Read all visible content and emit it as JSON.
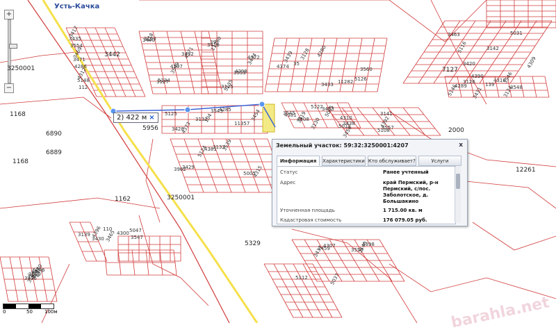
{
  "map": {
    "town_label": "Усть-Качка",
    "measure_label": "2) 422 м",
    "measure_close": "×",
    "zoom_in": "+",
    "zoom_out": "−",
    "zoom_fraction": 0.4,
    "scale_ticks": [
      "0",
      "50",
      "100м"
    ],
    "watermark": "barahla.net",
    "labels_big": [
      "3250001",
      "3250001",
      "1168",
      "6890",
      "6889",
      "1168",
      "3442",
      "1162",
      "5329",
      "7127",
      "2000",
      "12261",
      "5956"
    ],
    "labels_parcels": [
      "3417",
      "3440",
      "3418",
      "3439",
      "3428",
      "3429",
      "3419",
      "3438",
      "3420",
      "3437",
      "3430",
      "3436",
      "3431",
      "3435",
      "3432",
      "3434",
      "3433",
      "3543",
      "3539",
      "3545",
      "3557",
      "3546",
      "3556",
      "3547",
      "3555",
      "3548",
      "3554",
      "3549",
      "3553",
      "3560",
      "3454",
      "3962",
      "3453",
      "3456",
      "3463",
      "3459",
      "3465",
      "3468",
      "3126",
      "3469",
      "3127",
      "3125",
      "3128",
      "3131",
      "3133",
      "3130",
      "3141",
      "3142",
      "3140",
      "3139",
      "3129",
      "3124",
      "3471",
      "3123",
      "11280",
      "11282",
      "11357",
      "4315",
      "4308",
      "4310",
      "4309",
      "4307",
      "4300",
      "4287",
      "4289",
      "4286",
      "4371",
      "4372",
      "4374",
      "4373",
      "4381",
      "4381",
      "4392",
      "4390",
      "4398",
      "4396",
      "4317",
      "4316",
      "4312",
      "4297",
      "4298",
      "4280",
      "4285",
      "5005",
      "5005",
      "5013",
      "5031",
      "5037",
      "5047",
      "5145",
      "5146",
      "5148",
      "5134",
      "5135",
      "5126",
      "5125",
      "5124",
      "5122",
      "5108",
      "5116",
      "5112",
      "110",
      "140",
      "139",
      "112",
      "118",
      "39",
      "35",
      "104"
    ],
    "popup": {
      "title": "Земельный участок: 59:32:3250001:4207",
      "close": "x",
      "tabs": [
        "Информация",
        "Характеристики",
        "Кто обслуживает?",
        "Услуги"
      ],
      "rows": [
        {
          "label": "Статус",
          "value": "Ранее учтенный"
        },
        {
          "label": "Адрес",
          "value": "край Пермский, р-н Пермский, с/пос. Заболотское, д. Большакино"
        },
        {
          "label": "Уточненная площадь",
          "value": "1 715.00 кв. м"
        },
        {
          "label": "Кадастровая стоимость",
          "value": "176 079.05 руб."
        }
      ]
    }
  }
}
